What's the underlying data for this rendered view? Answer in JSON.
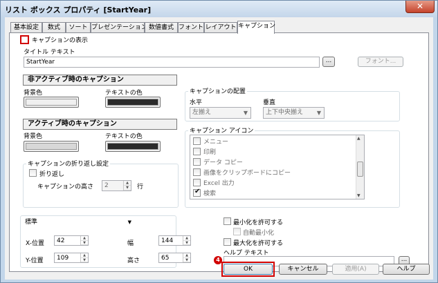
{
  "window": {
    "title": "リスト ボックス プロパティ [StartYear]",
    "close_glyph": "✕"
  },
  "tabs": [
    "基本設定",
    "数式",
    "ソート",
    "プレゼンテーション",
    "数値書式",
    "フォント",
    "レイアウト",
    "キャプション"
  ],
  "active_tab": "キャプション",
  "caption": {
    "show_caption_label": "キャプションの表示",
    "title_text_label": "タイトル テキスト",
    "title_text_value": "StartYear",
    "ellipsis": "...",
    "font_button": "フォント..."
  },
  "inactive": {
    "heading": "非アクティブ時のキャプション",
    "bg_label": "背景色",
    "text_label": "テキストの色",
    "bg_color": "#f0f0f0",
    "text_color": "#2b2b2b"
  },
  "active": {
    "heading": "アクティブ時のキャプション",
    "bg_label": "背景色",
    "text_label": "テキストの色",
    "bg_color": "#d8d8d8",
    "text_color": "#2b2b2b"
  },
  "wrap": {
    "group_label": "キャプションの折り返し設定",
    "wrap_checkbox": "折り返し",
    "height_label": "キャプションの高さ",
    "height_value": "2",
    "height_unit": "行"
  },
  "alignment": {
    "group_label": "キャプションの配置",
    "horizontal_label": "水平",
    "vertical_label": "垂直",
    "horizontal_value": "左揃え",
    "vertical_value": "上下中央揃え"
  },
  "icons": {
    "group_label": "キャプション アイコン",
    "items": [
      {
        "label": "メニュー",
        "checked": false
      },
      {
        "label": "印刷",
        "checked": false
      },
      {
        "label": "データ コピー",
        "checked": false
      },
      {
        "label": "画像をクリップボードにコピー",
        "checked": false
      },
      {
        "label": "Excel 出力",
        "checked": false
      },
      {
        "label": "検索",
        "checked": true
      }
    ]
  },
  "position": {
    "mode_value": "標準",
    "x_label": "X-位置",
    "x_value": "42",
    "y_label": "Y-位置",
    "y_value": "109",
    "width_label": "幅",
    "width_value": "144",
    "height_label": "高さ",
    "height_value": "65"
  },
  "options": {
    "allow_minimize": "最小化を許可する",
    "auto_minimize": "自動最小化",
    "allow_maximize": "最大化を許可する",
    "help_text_label": "ヘルプ テキスト"
  },
  "buttons": {
    "ok": "OK",
    "cancel": "キャンセル",
    "apply": "適用(A)",
    "help": "ヘルプ"
  },
  "annotation": {
    "step_number": "4",
    "highlight_color": "#d10000"
  }
}
